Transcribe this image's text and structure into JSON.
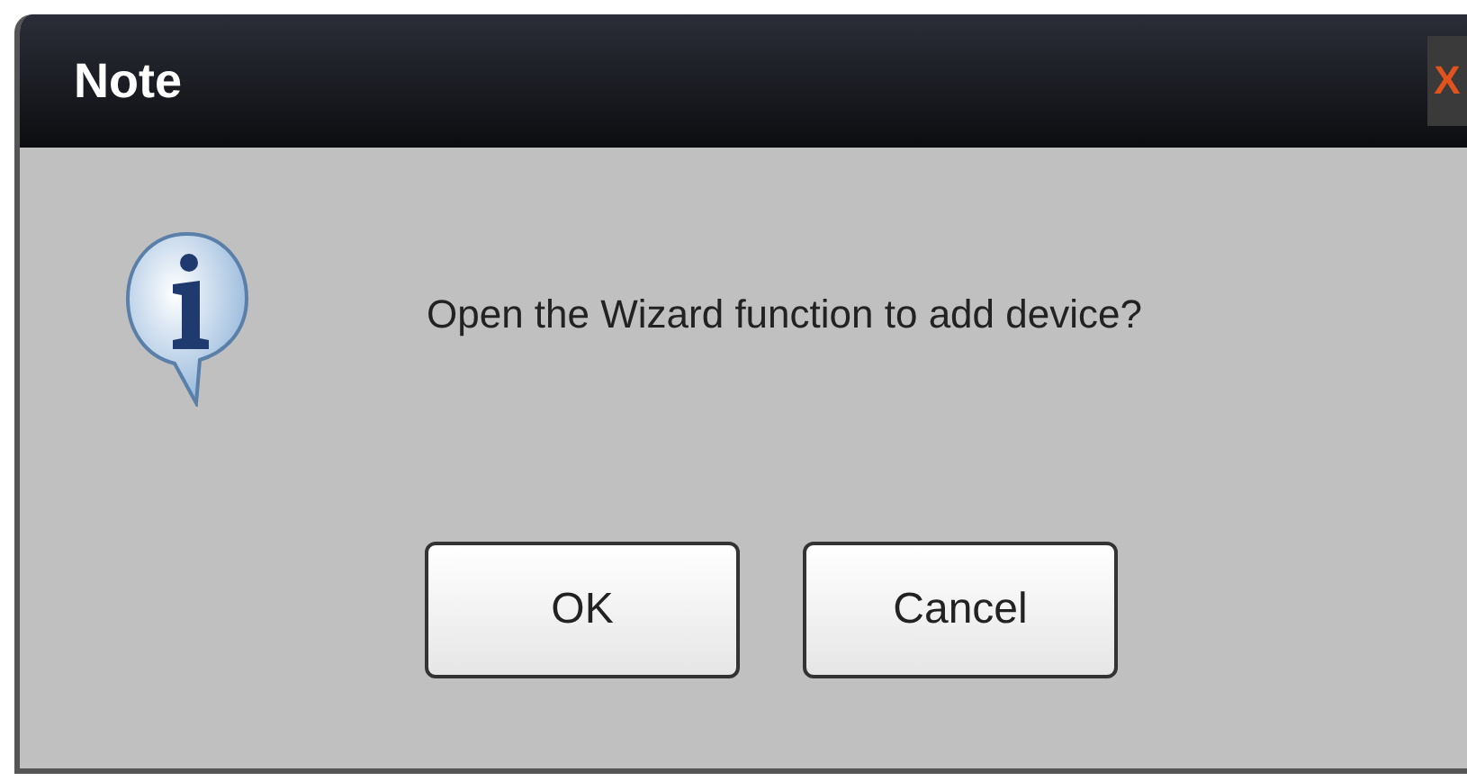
{
  "window": {
    "title": "Note",
    "close": "X"
  },
  "message": "Open the Wizard function to add device?",
  "buttons": [
    "OK",
    "Cancel"
  ]
}
